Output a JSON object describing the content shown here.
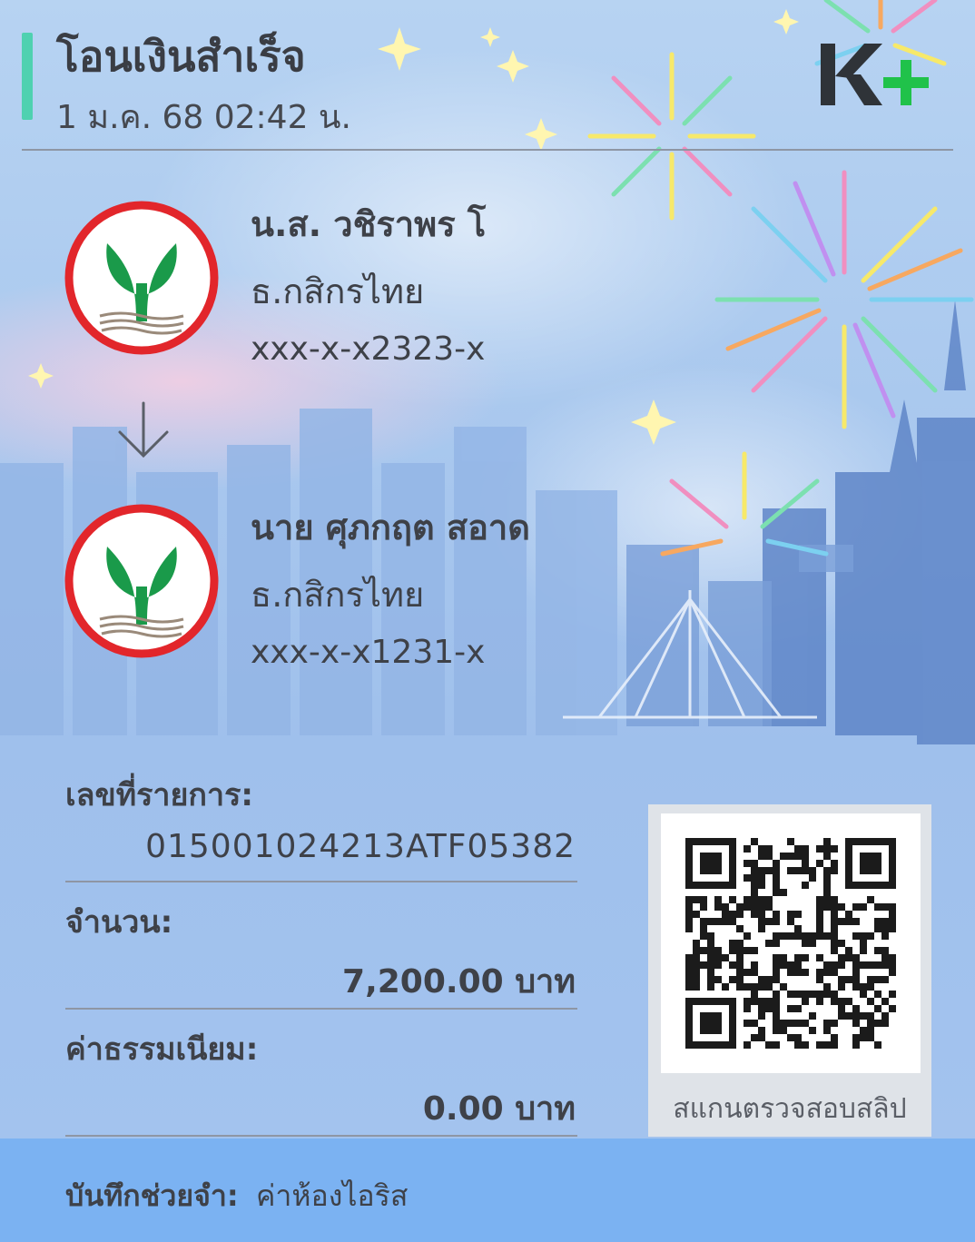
{
  "header": {
    "title": "โอนเงินสำเร็จ",
    "datetime": "1 ม.ค. 68  02:42 น.",
    "brand_logo": "K+"
  },
  "sender": {
    "name": "น.ส. วชิราพร โ",
    "bank": "ธ.กสิกรไทย",
    "account": "xxx-x-x2323-x"
  },
  "receiver": {
    "name": "นาย ศุภกฤต สอาด",
    "bank": "ธ.กสิกรไทย",
    "account": "xxx-x-x1231-x"
  },
  "details": {
    "ref_label": "เลขที่รายการ:",
    "ref_value": "015001024213ATF05382",
    "amount_label": "จำนวน:",
    "amount_value": "7,200.00 บาท",
    "fee_label": "ค่าธรรมเนียม:",
    "fee_value": "0.00 บาท"
  },
  "qr": {
    "caption": "สแกนตรวจสอบสลิป"
  },
  "memo": {
    "label": "บันทึกช่วยจำ:",
    "value": "ค่าห้องไอริส"
  },
  "colors": {
    "accent": "#4fd1b0",
    "kbank_green": "#1a9a4a",
    "kbank_red": "#e2262b",
    "memo_bar": "#7bb2f2"
  },
  "icons": [
    "down-arrow-icon",
    "kbank-logo-icon",
    "kplus-logo-icon",
    "qr-code-icon"
  ]
}
